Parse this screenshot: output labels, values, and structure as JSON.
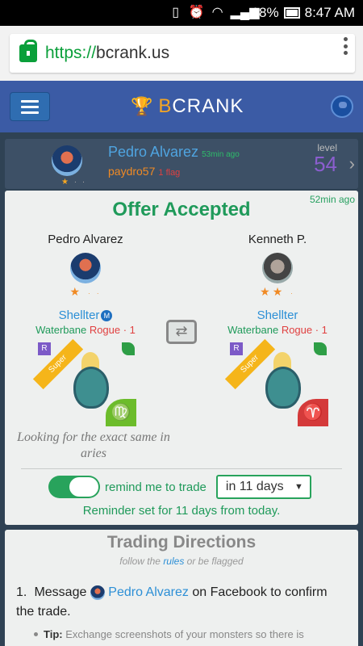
{
  "statusbar": {
    "battery": "18%",
    "time": "8:47 AM"
  },
  "browser": {
    "scheme": "https://",
    "domain": "bcrank.us"
  },
  "header": {
    "brand_b": "B",
    "brand_rest": "CRANK"
  },
  "user": {
    "name": "Pedro Alvarez",
    "ago": "53min ago",
    "handle": "paydro57",
    "flags": "1 flag",
    "level_label": "level",
    "level": "54",
    "stars": "★",
    "stars_dim": "· ·"
  },
  "offer": {
    "ago": "52min ago",
    "title": "Offer Accepted",
    "left": {
      "name": "Pedro Alvarez",
      "stars": "★",
      "stars_dim": "· ·",
      "monster": "Shellter",
      "badge": "M",
      "element": "Waterbane",
      "cls": "Rogue · 1",
      "rarity": "R",
      "ribbon": "Super",
      "zodiac": "♍"
    },
    "right": {
      "name": "Kenneth P.",
      "stars": "★★",
      "stars_dim": "·",
      "monster": "Shellter",
      "element": "Waterbane",
      "cls": "Rogue · 1",
      "rarity": "R",
      "ribbon": "Super",
      "zodiac": "♈"
    },
    "swap_icon": "⇄",
    "looking": "Looking for the exact same in aries",
    "remind_label": "remind me to trade",
    "remind_select": "in 11 days",
    "reminder_msg": "Reminder set for 11 days from today."
  },
  "directions": {
    "title": "Trading Directions",
    "sub_before": "follow the",
    "sub_link": "rules",
    "sub_after": "or be flagged",
    "step_num": "1.",
    "step_before": "Message",
    "step_name": "Pedro Alvarez",
    "step_after": "on Facebook to confirm the trade.",
    "tip_label": "Tip:",
    "tip_text": "Exchange screenshots of your monsters so there is"
  }
}
